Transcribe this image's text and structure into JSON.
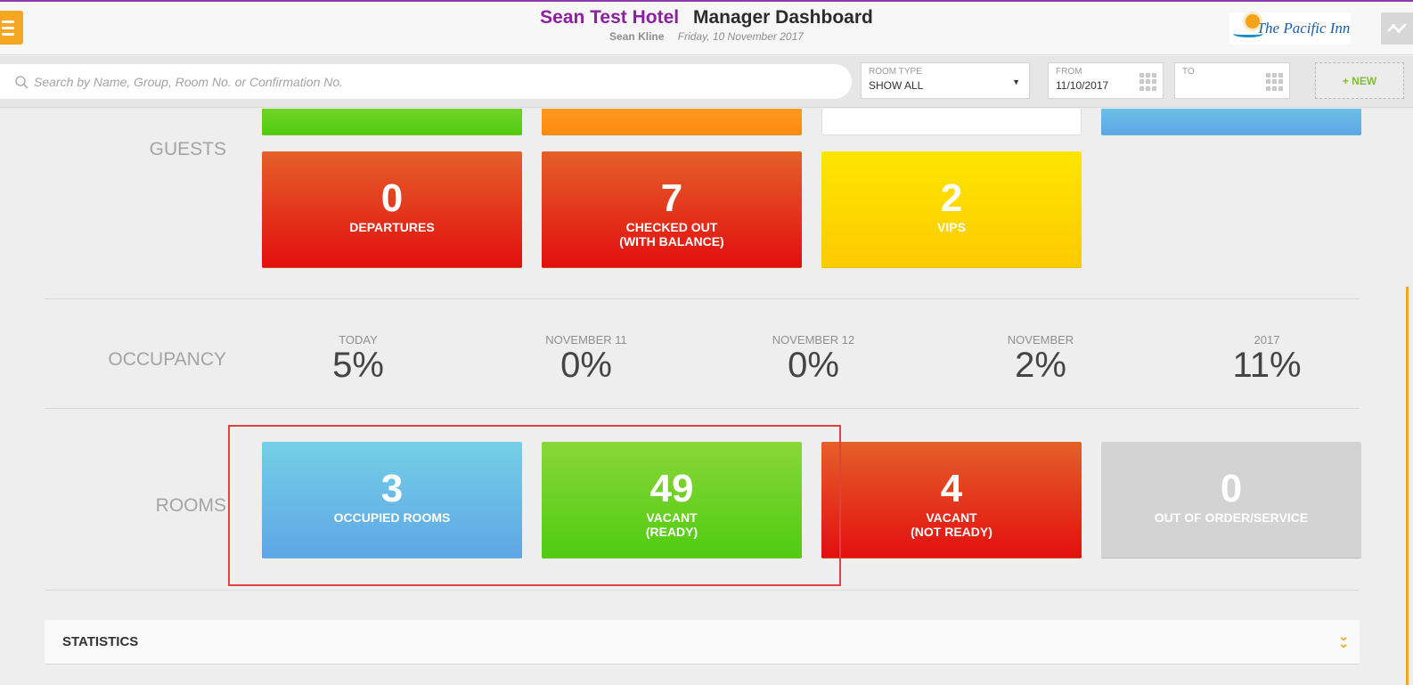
{
  "header": {
    "hotel_name": "Sean Test Hotel",
    "title": "Manager Dashboard",
    "user": "Sean Kline",
    "date": "Friday, 10 November 2017",
    "logo_text": "The Pacific Inn"
  },
  "search": {
    "placeholder": "Search by Name, Group, Room No. or Confirmation No.",
    "value": ""
  },
  "filters": {
    "room_type_label": "ROOM TYPE",
    "room_type_value": "SHOW ALL",
    "from_label": "FROM",
    "from_value": "11/10/2017",
    "to_label": "TO",
    "to_value": "",
    "new_button": "+ NEW"
  },
  "guests": {
    "label": "GUESTS",
    "tiles": [
      {
        "value": "0",
        "label": "DEPARTURES",
        "sublabel": ""
      },
      {
        "value": "7",
        "label": "CHECKED OUT",
        "sublabel": "(WITH BALANCE)"
      },
      {
        "value": "2",
        "label": "VIPS",
        "sublabel": ""
      }
    ]
  },
  "occupancy": {
    "label": "OCCUPANCY",
    "columns": [
      {
        "caption": "TODAY",
        "value": "5%"
      },
      {
        "caption": "NOVEMBER 11",
        "value": "0%"
      },
      {
        "caption": "NOVEMBER 12",
        "value": "0%"
      },
      {
        "caption": "NOVEMBER",
        "value": "2%"
      },
      {
        "caption": "2017",
        "value": "11%"
      }
    ]
  },
  "rooms": {
    "label": "ROOMS",
    "tiles": [
      {
        "value": "3",
        "label": "OCCUPIED ROOMS",
        "sublabel": ""
      },
      {
        "value": "49",
        "label": "VACANT",
        "sublabel": "(READY)"
      },
      {
        "value": "4",
        "label": "VACANT",
        "sublabel": "(NOT READY)"
      },
      {
        "value": "0",
        "label": "OUT OF ORDER/SERVICE",
        "sublabel": ""
      }
    ]
  },
  "statistics": {
    "label": "STATISTICS"
  },
  "colors": {
    "accent": "#f5a623",
    "hotel_name": "#8e1fa0",
    "red": "#e30f0f",
    "yellow": "#fdd500",
    "blue": "#5ea6e6",
    "green": "#4fcc10",
    "grey": "#d3d3d3"
  }
}
